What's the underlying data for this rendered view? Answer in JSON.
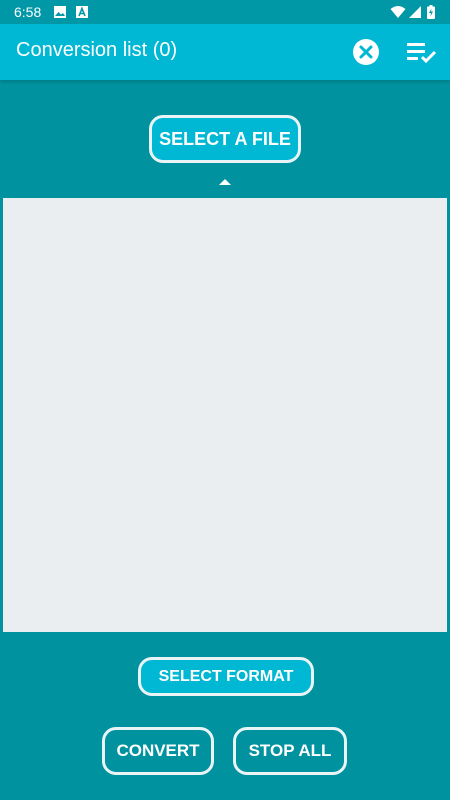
{
  "status_bar": {
    "time": "6:58",
    "icons": [
      "image-icon",
      "a-notification-icon",
      "wifi-icon",
      "cell-signal-icon",
      "battery-icon"
    ]
  },
  "app_bar": {
    "title": "Conversion list (0)",
    "actions": [
      "clear-icon",
      "checklist-icon"
    ]
  },
  "buttons": {
    "select_file": "SELECT A FILE",
    "select_format": "SELECT FORMAT",
    "convert": "CONVERT",
    "stop_all": "STOP ALL"
  },
  "colors": {
    "background": "#00929f",
    "app_bar": "#00b8d4",
    "list_area": "#eaeef1"
  }
}
